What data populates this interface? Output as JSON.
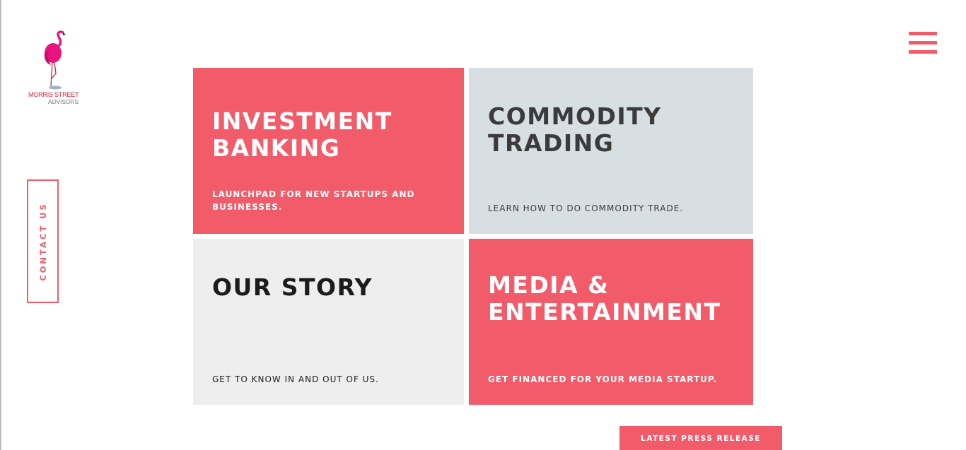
{
  "brand": {
    "name_line1": "MORRIS STREET",
    "name_line2": "ADVISORS",
    "logo_icon": "flamingo-icon",
    "colors": {
      "accent": "#f25c6a",
      "logo_pink": "#e8147f",
      "logo_red": "#d6243b"
    }
  },
  "header": {
    "menu_icon": "hamburger-menu-icon"
  },
  "sidebar": {
    "contact_label": "CONTACT US"
  },
  "tiles": [
    {
      "title_line1": "INVESTMENT",
      "title_line2": "BANKING",
      "subtitle": "LAUNCHPAD FOR NEW STARTUPS AND BUSINESSES.",
      "background": "#f25c6a"
    },
    {
      "title_line1": "COMMODITY",
      "title_line2": "TRADING",
      "subtitle": "LEARN HOW TO DO COMMODITY TRADE.",
      "background": "#d7dfe2"
    },
    {
      "title_line1": "OUR STORY",
      "title_line2": "",
      "subtitle": "GET TO KNOW IN AND OUT OF US.",
      "background": "#eeeeee"
    },
    {
      "title_line1": "MEDIA &",
      "title_line2": "ENTERTAINMENT",
      "subtitle": "GET FINANCED FOR YOUR MEDIA STARTUP.",
      "background": "#f25c6a"
    }
  ],
  "footer": {
    "press_label": "LATEST PRESS RELEASE"
  }
}
